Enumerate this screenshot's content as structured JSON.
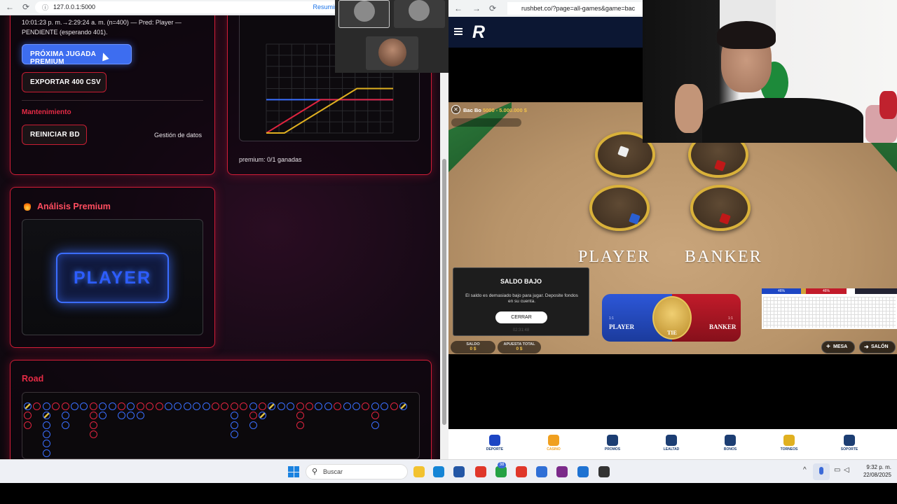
{
  "left_browser": {
    "url": "127.0.0.1:5000",
    "resumir": "Resumir",
    "info_line1": "10:01:23 p. m.→2:29:24 a. m. (n=400) — Pred: Player —",
    "info_line2": "PENDIENTE (esperando 401).",
    "btn_premium": "PRÓXIMA JUGADA PREMIUM",
    "btn_export": "EXPORTAR 400 CSV",
    "mantenimiento": "Mantenimiento",
    "btn_reiniciar": "REINICIAR BD",
    "gestion": "Gestión de datos",
    "chart_caption": "premium: 0/1 ganadas",
    "analysis_title": "Análisis Premium",
    "prediction": "PLAYER",
    "road_title": "Road"
  },
  "right_browser": {
    "url": "rushbet.co/?page=all-games&game=bac",
    "table_name": "Bac Bo",
    "limits": "5000 - 5.000.000 $",
    "player": "PLAYER",
    "banker": "BANKER",
    "modal": {
      "title": "SALDO BAJO",
      "message": "El saldo es demasiado bajo para jugar. Deposite fondos en su cuenta.",
      "button": "CERRAR",
      "code": "02:31:48"
    },
    "bets": {
      "player": "PLAYER",
      "tie": "TIE",
      "banker": "BANKER",
      "player_odds": "1:1",
      "banker_odds": "1:1"
    },
    "saldo_label": "SALDO",
    "saldo_value": "0 $",
    "apuesta_label": "APUESTA TOTAL",
    "apuesta_value": "0 $",
    "mesa": "MESA",
    "salon": "SALÓN",
    "stats": {
      "player_pct": "46%",
      "banker_pct": "46%"
    },
    "nav": [
      "DEPORTE",
      "CASINO",
      "PROMOS",
      "LEALTAD",
      "BONOS",
      "TORNEOS",
      "SOPORTE"
    ]
  },
  "taskbar": {
    "search": "Buscar",
    "time": "9:32 p. m.",
    "date": "22/08/2025",
    "badge": "38"
  },
  "road": {
    "rows": [
      [
        "T",
        "R",
        "B",
        "R",
        "R",
        "B",
        "B",
        "R",
        "B",
        "B",
        "R",
        "B",
        "R",
        "R",
        "R",
        "B",
        "B",
        "B",
        "B",
        "B",
        "R",
        "R",
        "R",
        "R",
        "B",
        "R",
        "T",
        "B",
        "B",
        "R",
        "R",
        "B",
        "B",
        "R",
        "B",
        "B",
        "R",
        "B",
        "B",
        "R",
        "T"
      ],
      [
        "R",
        "",
        "T",
        "",
        "B",
        "",
        "",
        "R",
        "B",
        "",
        "B",
        "B",
        "B",
        "",
        "",
        "",
        "",
        "",
        "",
        "",
        "",
        "",
        "B",
        "",
        "R",
        "T",
        "",
        "",
        "",
        "R",
        "",
        "",
        "",
        "",
        "",
        "",
        "",
        "R",
        "",
        "",
        ""
      ],
      [
        "R",
        "",
        "B",
        "",
        "B",
        "",
        "",
        "R",
        "",
        "",
        "",
        "",
        "",
        "",
        "",
        "",
        "",
        "",
        "",
        "",
        "",
        "",
        "B",
        "",
        "B",
        "",
        "",
        "",
        "",
        "R",
        "",
        "",
        "",
        "",
        "",
        "",
        "",
        "B",
        "",
        "",
        ""
      ],
      [
        "",
        "",
        "B",
        "",
        "",
        "",
        "",
        "R",
        "",
        "",
        "",
        "",
        "",
        "",
        "",
        "",
        "",
        "",
        "",
        "",
        "",
        "",
        "B",
        "",
        "",
        "",
        "",
        "",
        "",
        "",
        "",
        "",
        "",
        "",
        "",
        "",
        "",
        "",
        "",
        "",
        ""
      ],
      [
        "",
        "",
        "B",
        "",
        "",
        "",
        "",
        "",
        "",
        "",
        "",
        "",
        "",
        "",
        "",
        "",
        "",
        "",
        "",
        "",
        "",
        "",
        "",
        "",
        "",
        "",
        "",
        "",
        "",
        "",
        "",
        "",
        "",
        "",
        "",
        "",
        "",
        "",
        "",
        "",
        ""
      ],
      [
        "",
        "",
        "B",
        "",
        "",
        "",
        "",
        "",
        "",
        "",
        "",
        "",
        "",
        "",
        "",
        "",
        "",
        "",
        "",
        "",
        "",
        "",
        "",
        "",
        "",
        "",
        "",
        "",
        "",
        "",
        "",
        "",
        "",
        "",
        "",
        "",
        "",
        "",
        "",
        "",
        ""
      ]
    ]
  },
  "chart_data": {
    "type": "line",
    "series": [
      {
        "color": "#3a6fff",
        "values": [
          0,
          0,
          0,
          0,
          0,
          0,
          0,
          0
        ]
      },
      {
        "color": "#e0243f",
        "values": [
          -3,
          -2,
          -1,
          0,
          0,
          0,
          0,
          0
        ]
      },
      {
        "color": "#e0b020",
        "values": [
          -3,
          -3,
          -2,
          -1,
          0,
          1,
          1,
          1
        ]
      }
    ],
    "grid": true
  }
}
